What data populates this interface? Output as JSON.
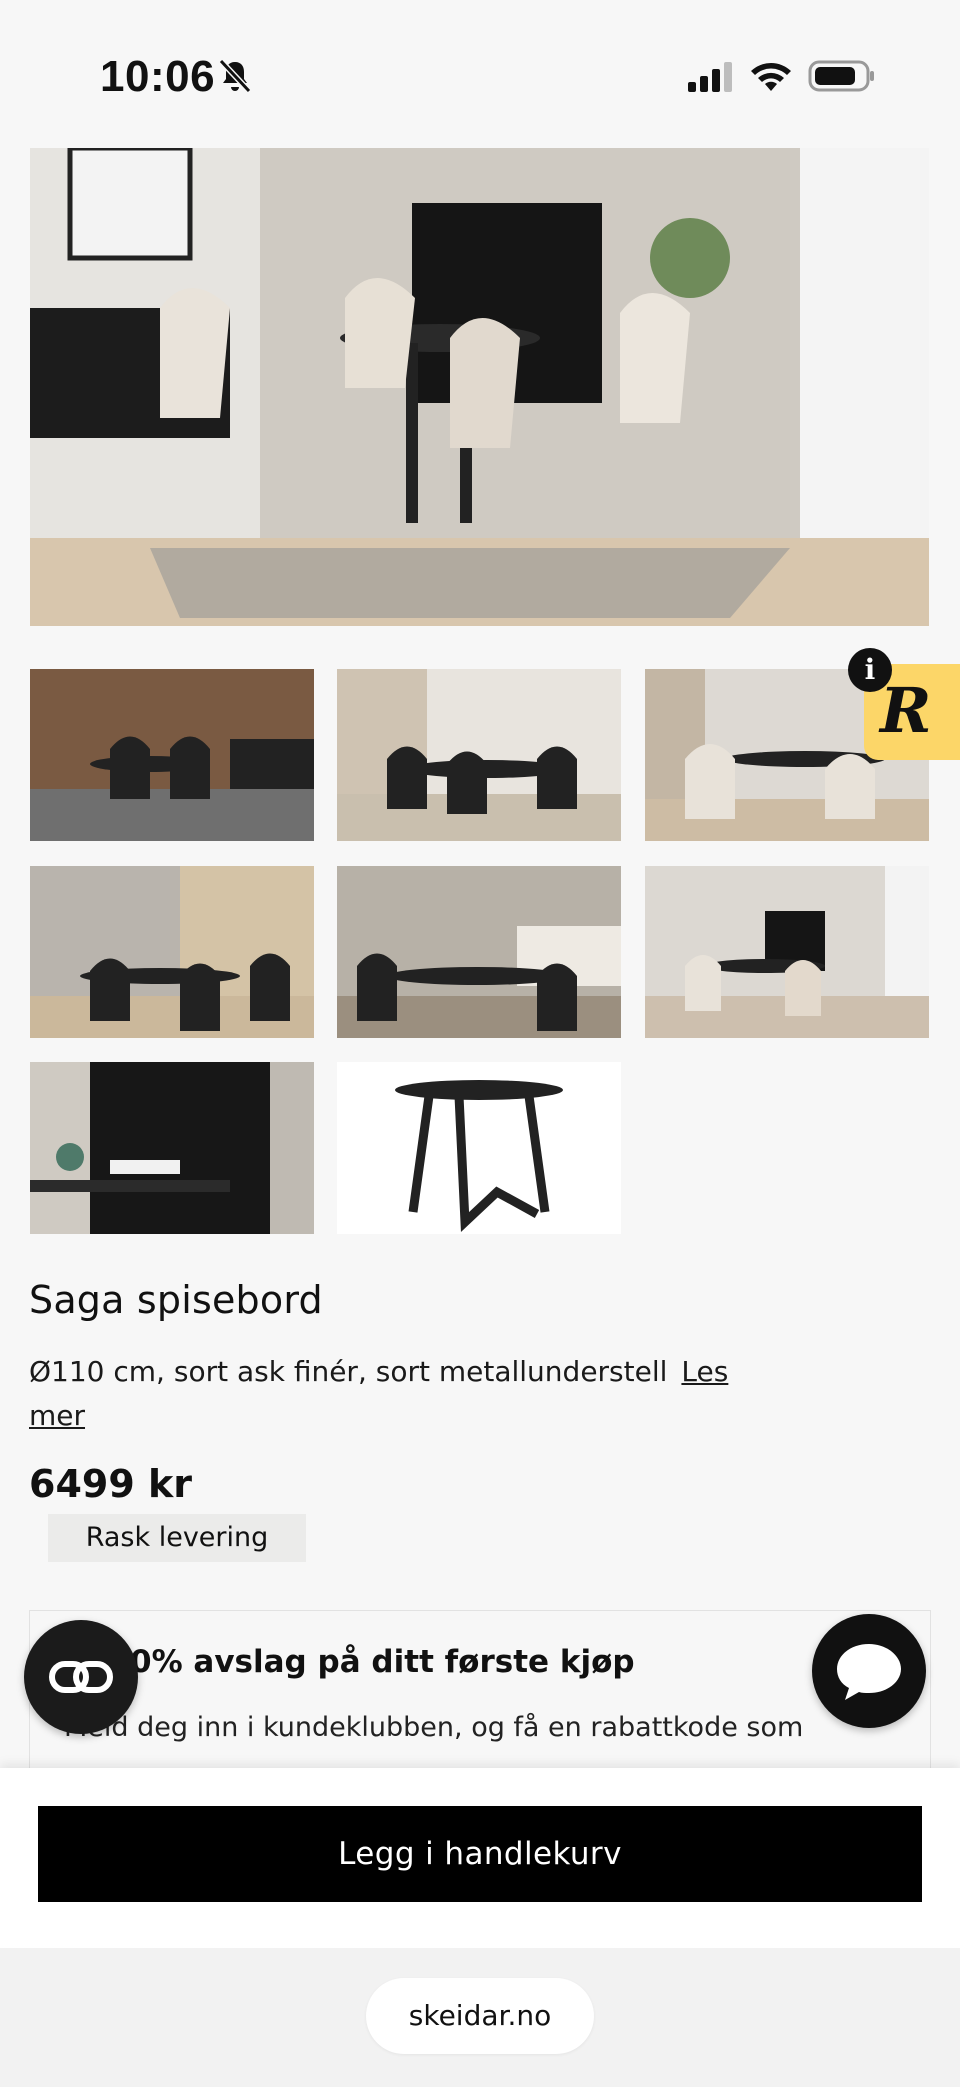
{
  "status_bar": {
    "time": "10:06",
    "icons": [
      "bell-slash-icon",
      "cellular-signal-icon",
      "wifi-icon",
      "battery-icon"
    ]
  },
  "gallery": {
    "hero_alt_icon": "dining-room-photo",
    "thumbnails_count": 8
  },
  "review_widget": {
    "info_glyph": "i",
    "logo_glyph": "R",
    "accent_color": "#fcd668"
  },
  "product": {
    "title": "Saga spisebord",
    "description": "Ø110 cm, sort ask finér, sort metallunderstell",
    "read_more_label": "Les mer",
    "price": "6499 kr",
    "delivery_badge": "Rask levering"
  },
  "club_banner": {
    "title": "0% avslag på ditt første kjøp",
    "text": "Meld deg inn i kundeklubben, og få en rabattkode som"
  },
  "floating": {
    "left_icon": "link-icon",
    "right_icon": "chat-bubble-icon"
  },
  "cta": {
    "add_to_cart_label": "Legg i handlekurv"
  },
  "browser": {
    "url": "skeidar.no"
  },
  "colors": {
    "background": "#f7f7f7",
    "cta_background": "#000000",
    "tag_background": "#ebebea"
  }
}
